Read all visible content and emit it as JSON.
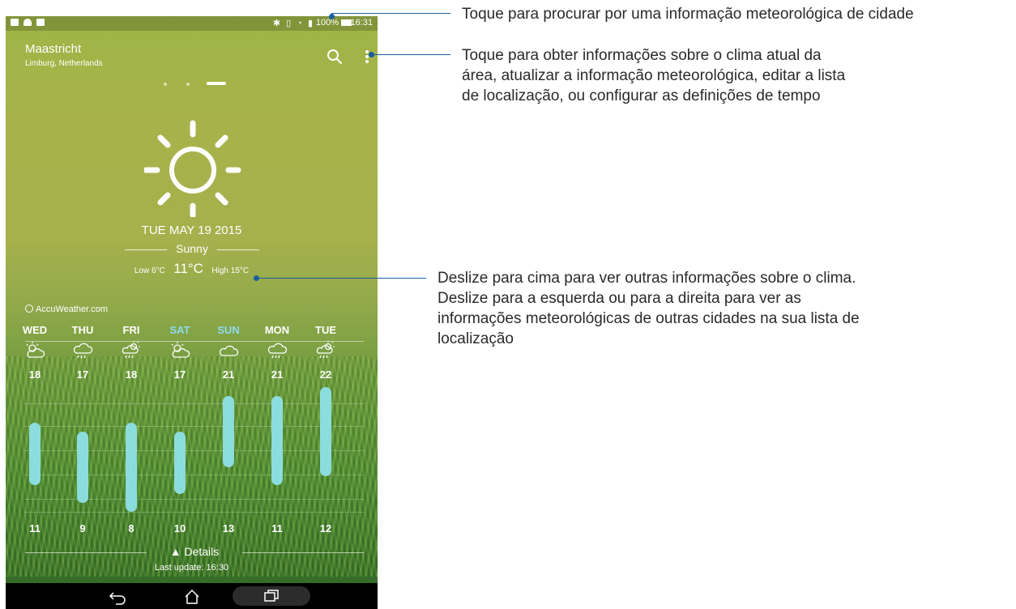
{
  "status_bar": {
    "battery": "100%",
    "time": "16:31"
  },
  "location": {
    "city": "Maastricht",
    "region": "Limburg, Netherlands"
  },
  "icons": {
    "search": "search-icon",
    "menu": "more-vert-icon",
    "sun": "sun-icon"
  },
  "current": {
    "date": "TUE MAY 19 2015",
    "condition": "Sunny",
    "low": "Low 6°C",
    "temp": "11°C",
    "high": "High 15°C"
  },
  "provider": "AccuWeather.com",
  "forecast": [
    {
      "day": "WED",
      "icon": "partly-cloudy-icon",
      "high": "18",
      "low": "11",
      "highlight": false
    },
    {
      "day": "THU",
      "icon": "rain-cloud-icon",
      "high": "17",
      "low": "9",
      "highlight": false
    },
    {
      "day": "FRI",
      "icon": "sun-rain-icon",
      "high": "18",
      "low": "8",
      "highlight": false
    },
    {
      "day": "SAT",
      "icon": "partly-cloudy-icon",
      "high": "17",
      "low": "10",
      "highlight": true
    },
    {
      "day": "SUN",
      "icon": "cloud-icon",
      "high": "21",
      "low": "13",
      "highlight": true
    },
    {
      "day": "MON",
      "icon": "rain-cloud-icon",
      "high": "21",
      "low": "11",
      "highlight": false
    },
    {
      "day": "TUE",
      "icon": "sun-rain-icon",
      "high": "22",
      "low": "12",
      "highlight": false
    }
  ],
  "footer": {
    "details": "Details",
    "last_update": "Last update: 16:30"
  },
  "colors": {
    "accent_weekend": "#8fd9ef",
    "bar": "#8ee0e6",
    "callout": "#1a5ea0"
  },
  "callouts": {
    "search": "Toque para procurar por uma informação meteorológica de cidade",
    "menu_lines": [
      "Toque para obter informações sobre o clima atual da",
      "área, atualizar a informação meteorológica, editar a lista",
      "de localização, ou configurar as definições de tempo"
    ],
    "swipe_lines": [
      "Deslize para cima para ver outras informações sobre o clima.",
      "Deslize para a esquerda ou para a direita para ver as",
      "informações meteorológicas de outras cidades na sua lista de",
      "localização"
    ]
  }
}
